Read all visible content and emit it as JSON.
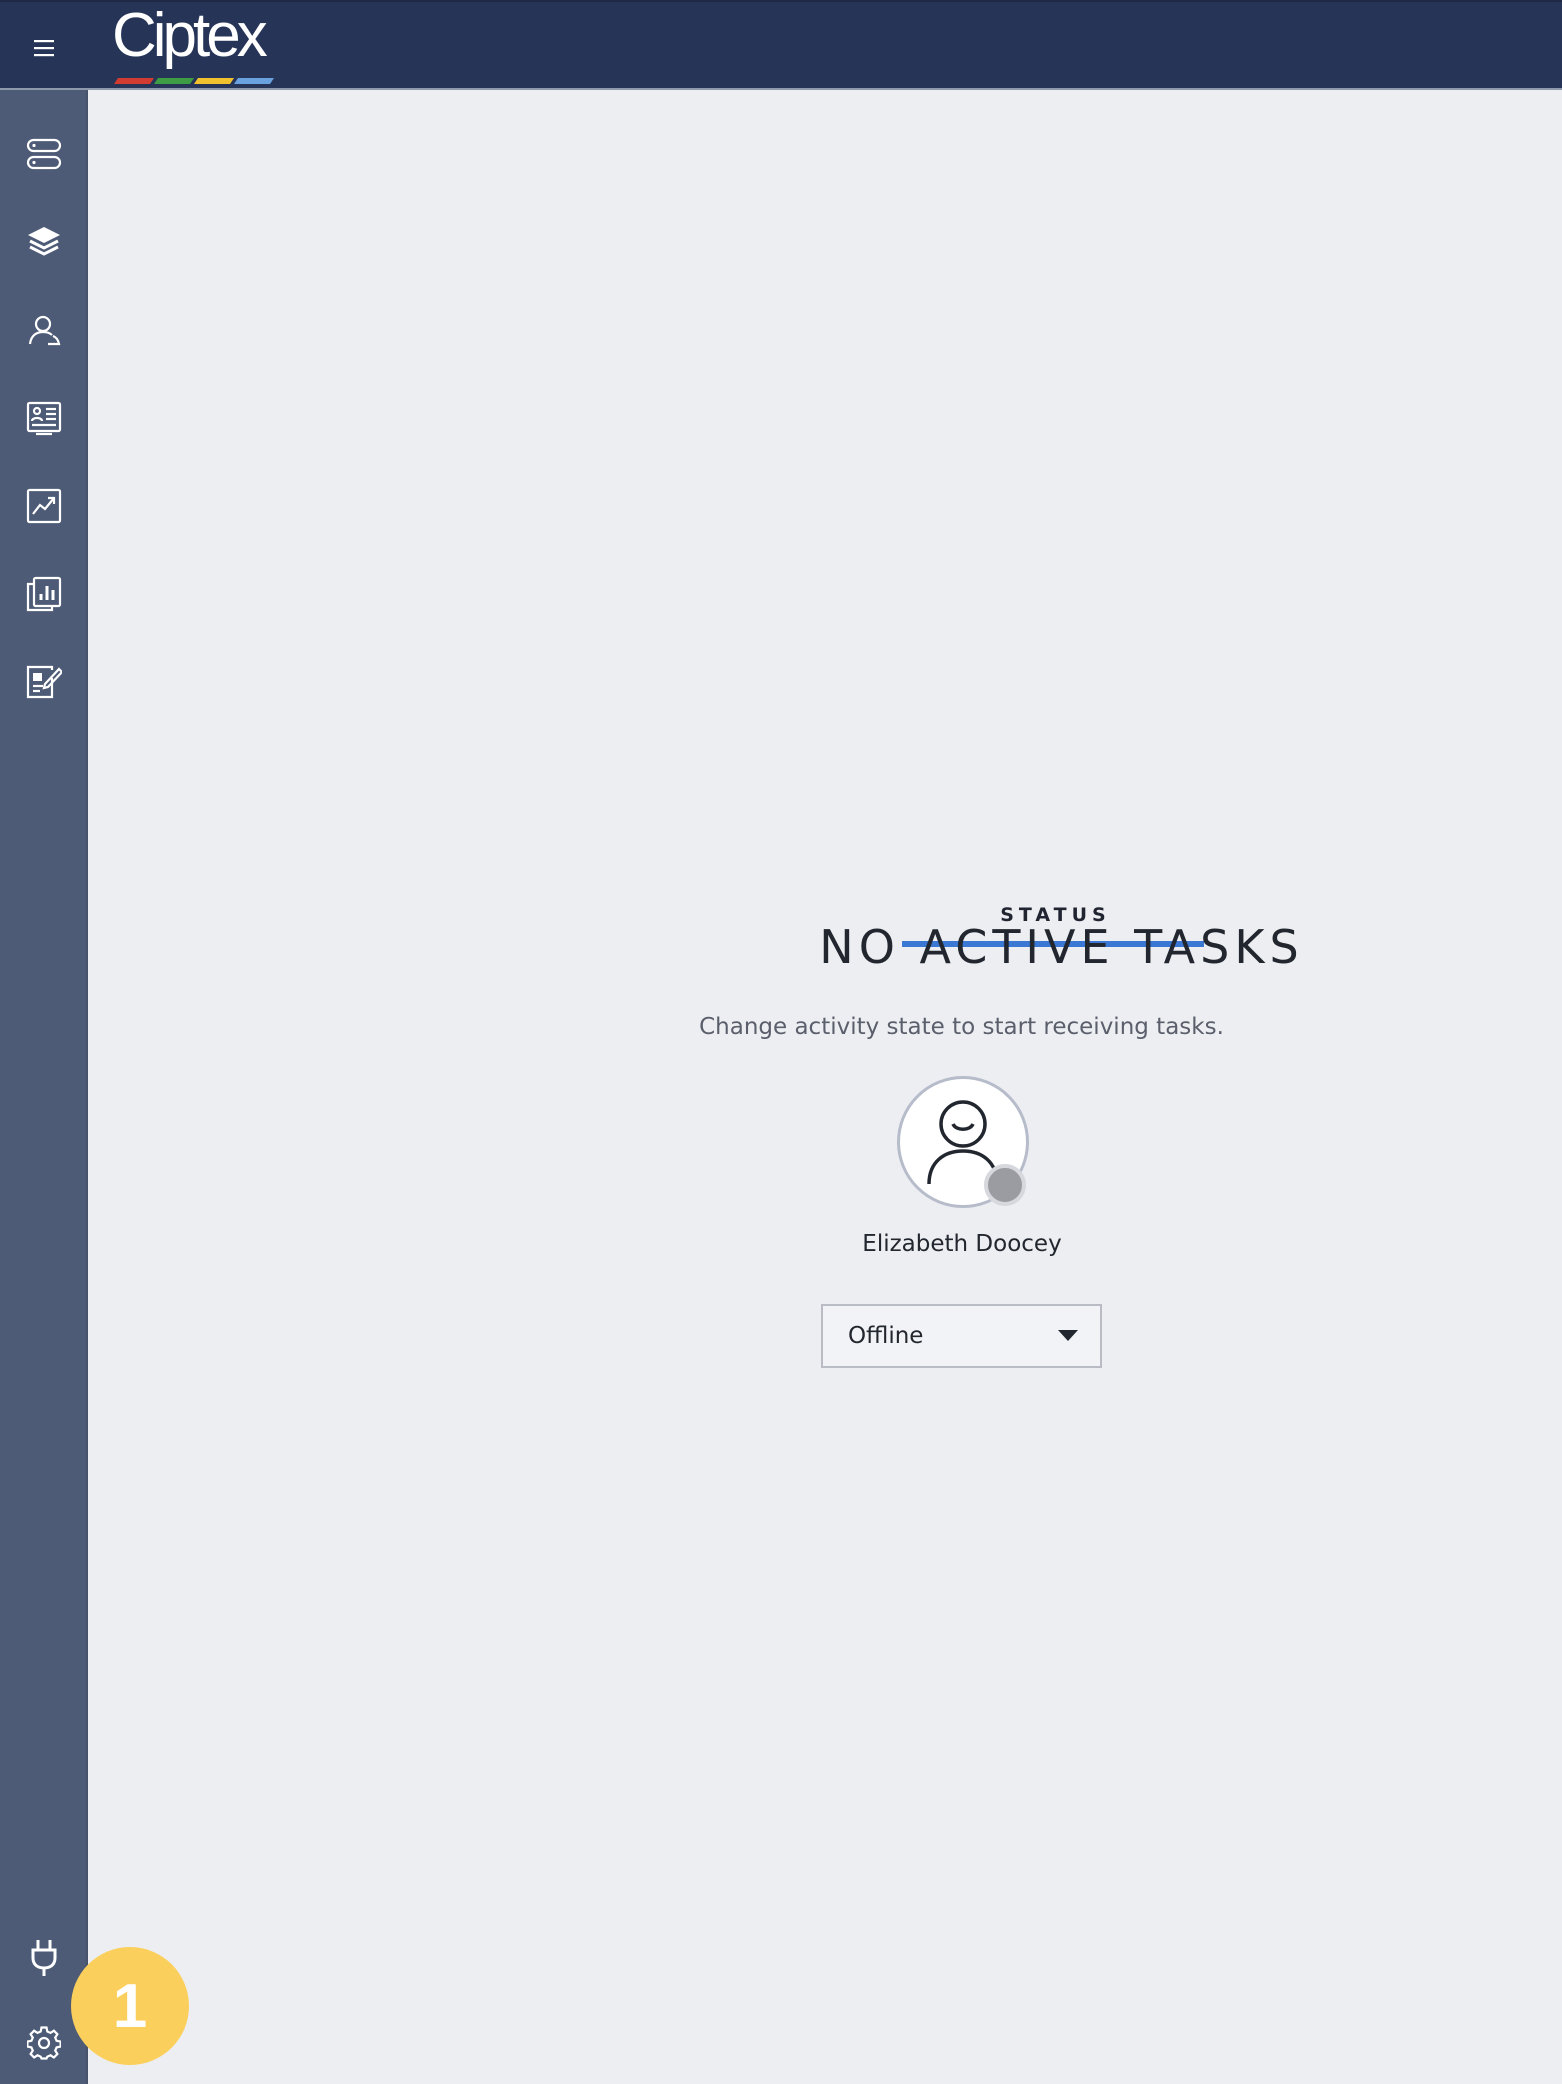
{
  "app": {
    "logo_text": "Ciptex",
    "logo_bar_colors": [
      "#d23b2f",
      "#3e9c45",
      "#f2c12e",
      "#6aa2df"
    ]
  },
  "header": {
    "menu_icon": "hamburger-icon"
  },
  "sidebar": {
    "items": [
      {
        "name": "sidebar-item-servers",
        "icon": "server-stack-icon"
      },
      {
        "name": "sidebar-item-layers",
        "icon": "layers-icon"
      },
      {
        "name": "sidebar-item-contacts",
        "icon": "contacts-icon"
      },
      {
        "name": "sidebar-item-directory",
        "icon": "id-card-icon"
      },
      {
        "name": "sidebar-item-analytics",
        "icon": "trend-chart-icon"
      },
      {
        "name": "sidebar-item-reports",
        "icon": "report-chart-icon"
      },
      {
        "name": "sidebar-item-forms",
        "icon": "edit-form-icon"
      }
    ],
    "bottom_items": [
      {
        "name": "sidebar-item-connection",
        "icon": "plug-icon"
      },
      {
        "name": "sidebar-item-settings",
        "icon": "gear-icon"
      }
    ],
    "notification_badge": "1"
  },
  "main": {
    "tab_label": "STATUS",
    "heading": "NO ACTIVE TASKS",
    "subtext": "Change activity state to start receiving tasks.",
    "user_name": "Elizabeth Doocey",
    "activity_select": {
      "value": "Offline"
    }
  },
  "colors": {
    "topbar": "#253457",
    "sidebar": "#4e5b77",
    "accent": "#3a78d4",
    "badge": "#fbcf5c",
    "offline_dot": "#9a9ca1"
  }
}
